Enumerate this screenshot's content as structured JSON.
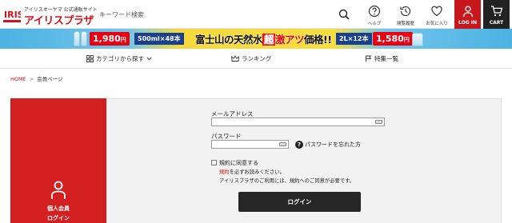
{
  "header": {
    "logo_mark": "IRIS",
    "logo_sub": "アイリスオーヤマ 公式通販サイト",
    "logo_main": "アイリスプラザ",
    "search_placeholder": "キーワード検索",
    "nav": [
      {
        "label": "ヘルプ",
        "icon": "question-icon"
      },
      {
        "label": "閲覧履歴",
        "icon": "history-icon"
      },
      {
        "label": "お気に入り",
        "icon": "heart-icon"
      },
      {
        "label": "LOG IN",
        "icon": "user-icon"
      },
      {
        "label": "CART",
        "icon": "cart-icon"
      }
    ],
    "colors": {
      "brand_red": "#d4111a",
      "login_bg": "#c8161d",
      "cart_bg": "#222222"
    }
  },
  "banner": {
    "price_left": "1,980",
    "price_left_unit": "円",
    "spec_left": "500ml×48本",
    "title_a": "富士山の天然水",
    "title_chou": "超",
    "title_b": "激アツ",
    "title_c": "価格!!",
    "spec_right": "2L×12本",
    "price_right": "1,580",
    "price_right_unit": "円"
  },
  "catnav": {
    "items": [
      {
        "label": "カテゴリから探す",
        "icon": "category-icon",
        "chevron": "chevron-down-icon"
      },
      {
        "label": "ランキング",
        "icon": "crown-icon"
      },
      {
        "label": "特集一覧",
        "icon": "feature-icon"
      }
    ]
  },
  "breadcrumb": {
    "home": "HOME",
    "separator": ">",
    "current": "会員ページ"
  },
  "member_panel": {
    "line1": "個人会員",
    "line2": "ログイン"
  },
  "form": {
    "email_label": "メールアドレス",
    "email_value": "",
    "password_label": "パスワード",
    "password_value": "",
    "forgot_icon_text": "?",
    "forgot_label": "パスワードを忘れた方",
    "agree_label": "規約に同意する",
    "note1_link": "規約",
    "note1_rest": "を必ずお読みください。",
    "note2": "アイリスプラザのご利用には、規約へのご同意が必要です。",
    "login_button": "ログイン"
  }
}
